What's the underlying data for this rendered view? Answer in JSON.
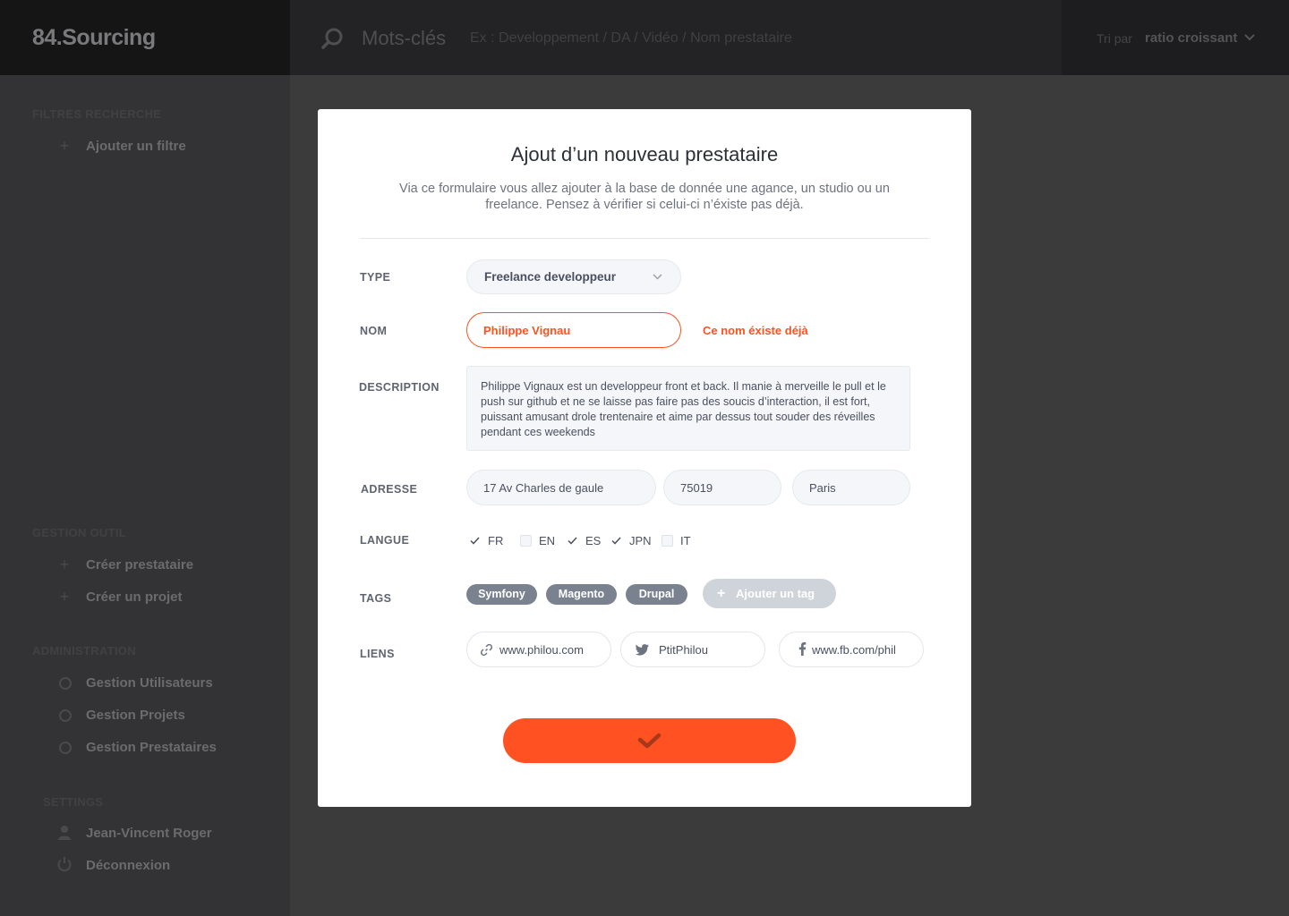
{
  "app": {
    "logo": "84.Sourcing"
  },
  "search": {
    "label": "Mots-clés",
    "placeholder": "Ex : Developpement / DA / Vidéo / Nom prestataire"
  },
  "sort": {
    "label": "Tri par",
    "value": "ratio croissant"
  },
  "sidebar": {
    "filters_title": "FILTRES RECHERCHE",
    "add_filter": "Ajouter un filtre",
    "tools_title": "GESTION OUTIL",
    "create_provider": "Créer prestataire",
    "create_project": "Créer un projet",
    "admin_title": "ADMINISTRATION",
    "admin_users": "Gestion Utilisateurs",
    "admin_projects": "Gestion Projets",
    "admin_providers": "Gestion Prestataires",
    "settings_title": "SETTINGS",
    "user_name": "Jean-Vincent Roger",
    "logout": "Déconnexion"
  },
  "modal": {
    "title": "Ajout d’un nouveau prestataire",
    "description": "Via ce formulaire vous allez ajouter à la base de donnée une agance, un studio ou un freelance. Pensez à vérifier si celui-ci n’éxiste pas déjà.",
    "type_label": "TYPE",
    "type_value": "Freelance developpeur",
    "name_label": "NOM",
    "name_value": "Philippe Vignau",
    "name_error": "Ce nom éxiste déjà",
    "desc_label": "DESCRIPTION",
    "desc_value": "Philippe Vignaux est un developpeur front et back. Il manie à merveille le pull et le push sur github et ne se laisse pas faire pas des soucis d’interaction, il est fort, puissant amusant drole trentenaire et aime par dessus tout souder des réveilles pendant ces weekends",
    "address_label": "ADRESSE",
    "address_street": "17 Av Charles de gaule",
    "address_zip": "75019",
    "address_city": "Paris",
    "lang_label": "LANGUE",
    "languages": [
      {
        "code": "FR",
        "checked": true
      },
      {
        "code": "EN",
        "checked": false
      },
      {
        "code": "ES",
        "checked": true
      },
      {
        "code": "JPN",
        "checked": true
      },
      {
        "code": "IT",
        "checked": false
      }
    ],
    "tags_label": "TAGS",
    "tags": [
      "Symfony",
      "Magento",
      "Drupal"
    ],
    "add_tag": "Ajouter un tag",
    "links_label": "LIENS",
    "link_web": "www.philou.com",
    "link_twitter": "PtitPhilou",
    "link_facebook": "www.fb.com/phil"
  },
  "colors": {
    "accent": "#ff5122",
    "tag": "#7a8290"
  }
}
